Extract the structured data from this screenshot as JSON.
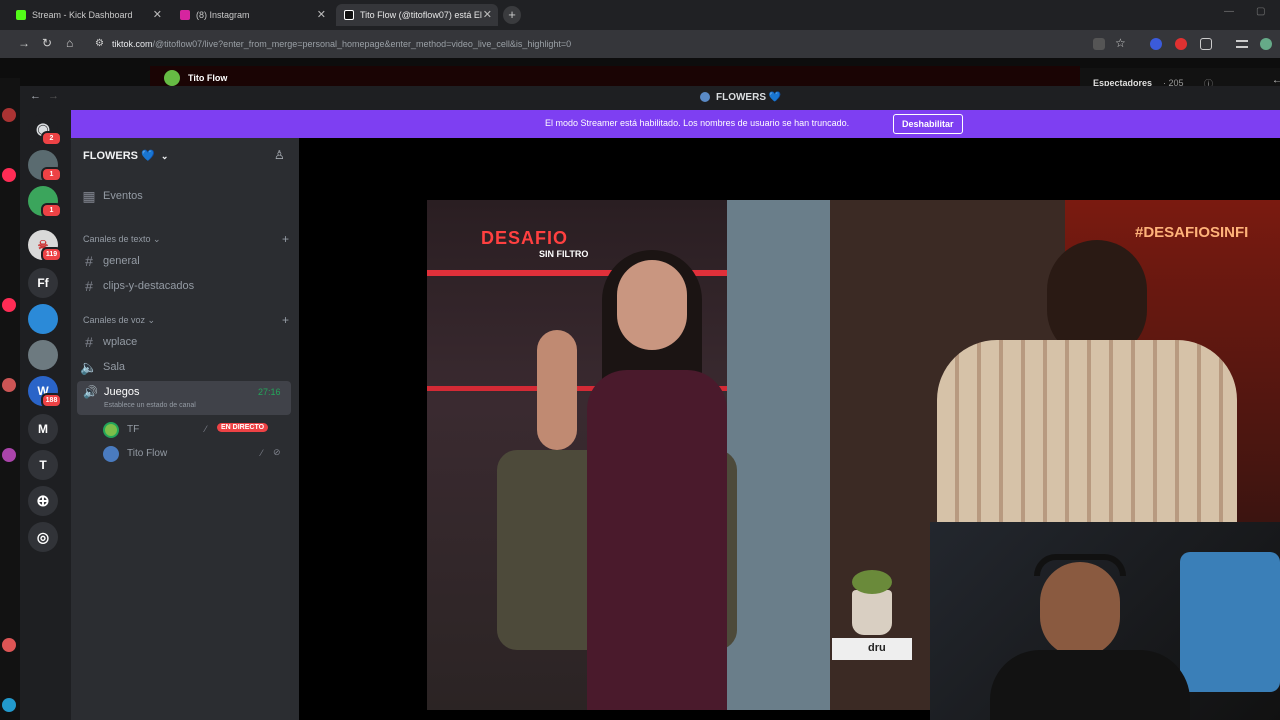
{
  "browser": {
    "tabs": [
      {
        "label": "Stream - Kick Dashboard",
        "color": "#53fc18"
      },
      {
        "label": "(8) Instagram",
        "color": "#d6249f"
      },
      {
        "label": "Tito Flow (@titoflow07) está El",
        "color": "#ffffff"
      }
    ],
    "new_tab": "+",
    "url_host": "tiktok.com",
    "url_path": "/@titoflow07/live?enter_from_merge=personal_homepage&enter_method=video_live_cell&is_highlight=0"
  },
  "tiktok": {
    "streamer_name": "Tito Flow",
    "viewers_label": "Espectadores",
    "viewers_count": "· 205"
  },
  "discord": {
    "window_title": "FLOWERS 💙",
    "banner_text": "El modo Streamer está habilitado. Los nombres de usuario se han truncado.",
    "banner_button": "Deshabilitar",
    "server_name": "FLOWERS 💙",
    "events_label": "Eventos",
    "text_category": "Canales de texto",
    "text_channels": [
      "general",
      "clips-y-destacados"
    ],
    "voice_category": "Canales de voz",
    "voice_channels": [
      "wplace",
      "Sala"
    ],
    "active_voice": {
      "name": "Juegos",
      "timer": "27:16",
      "status": "Establece un estado de canal"
    },
    "voice_users": [
      {
        "name": "TF",
        "live": "EN DIRECTO"
      },
      {
        "name": "Tito Flow",
        "live": ""
      }
    ],
    "guild_badges": [
      "2",
      "1",
      "1",
      "119",
      "188"
    ],
    "guild_letters": [
      "Ff",
      "M",
      "T"
    ]
  },
  "video": {
    "show_logo_main": "DESAFIO",
    "show_logo_sub": "SIN FILTRO",
    "hashtag": "#DESAFIOSINFI",
    "book_label": "dru"
  },
  "colors": {
    "streamer_banner": "#7e3ff2",
    "live_badge": "#ed4245",
    "timer": "#23a55a"
  }
}
